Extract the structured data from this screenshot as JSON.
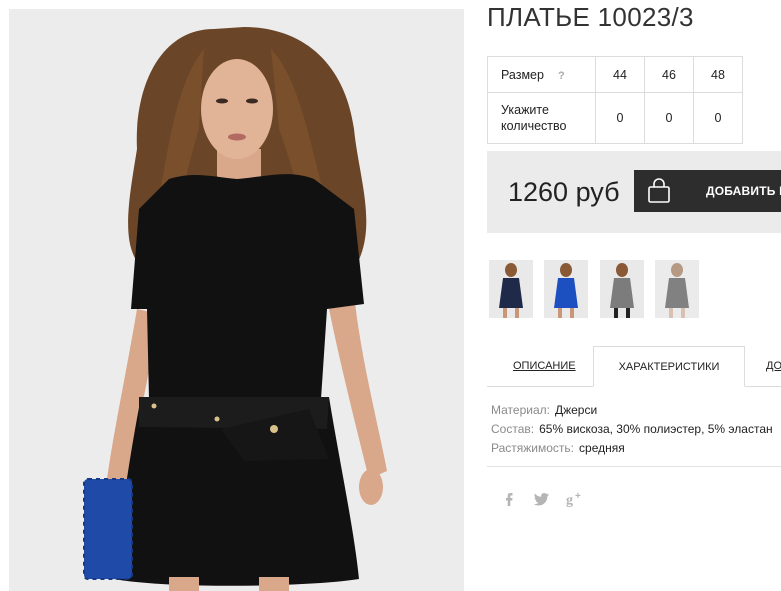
{
  "product": {
    "title": "ПЛАТЬЕ 10023/3",
    "price": "1260 руб"
  },
  "size_table": {
    "size_label": "Размер",
    "help_glyph": "?",
    "sizes": [
      "44",
      "46",
      "48"
    ],
    "qty_label_1": "Укажите",
    "qty_label_2": "количество",
    "quantities": [
      "0",
      "0",
      "0"
    ]
  },
  "cart": {
    "add_label": "ДОБАВИТЬ В"
  },
  "thumbnails": [
    {
      "dress_color": "#1f2a4a"
    },
    {
      "dress_color": "#1c4fc0"
    },
    {
      "dress_color": "#7c7c7c"
    },
    {
      "dress_color": "#3a3a3a"
    }
  ],
  "tabs": {
    "description": "ОПИСАНИЕ",
    "characteristics": "ХАРАКТЕРИСТИКИ",
    "third": "ДО"
  },
  "characteristics": [
    {
      "key": "Материал:",
      "value": "Джерси"
    },
    {
      "key": "Состав:",
      "value": "65% вискоза, 30% полиэстер, 5% эластан"
    },
    {
      "key": "Растяжимость:",
      "value": "средняя"
    }
  ],
  "colors": {
    "button_bg": "#2d2d2d",
    "price_box_bg": "#ebebeb",
    "dress": "#111111",
    "clutch": "#1f4aa8"
  }
}
